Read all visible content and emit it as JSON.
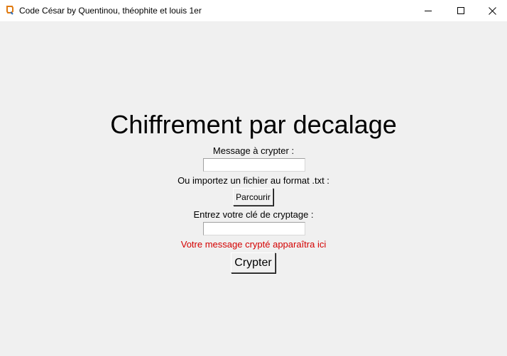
{
  "window": {
    "title": "Code César by Quentinou, théophite et louis 1er",
    "icon": "feather-tk-icon",
    "controls": [
      "minimize-icon",
      "maximize-icon",
      "close-icon"
    ]
  },
  "main": {
    "heading": "Chiffrement par decalage",
    "message_label": "Message à crypter :",
    "message_value": "",
    "import_label": "Ou importez un fichier au format .txt :",
    "browse_button": "Parcourir",
    "key_label": "Entrez votre clé de cryptage :",
    "key_value": "",
    "result_text": "Votre message crypté apparaîtra ici",
    "crypt_button": "Crypter"
  },
  "colors": {
    "background": "#f0f0f0",
    "titlebar": "#ffffff",
    "result_text": "#d40000"
  }
}
